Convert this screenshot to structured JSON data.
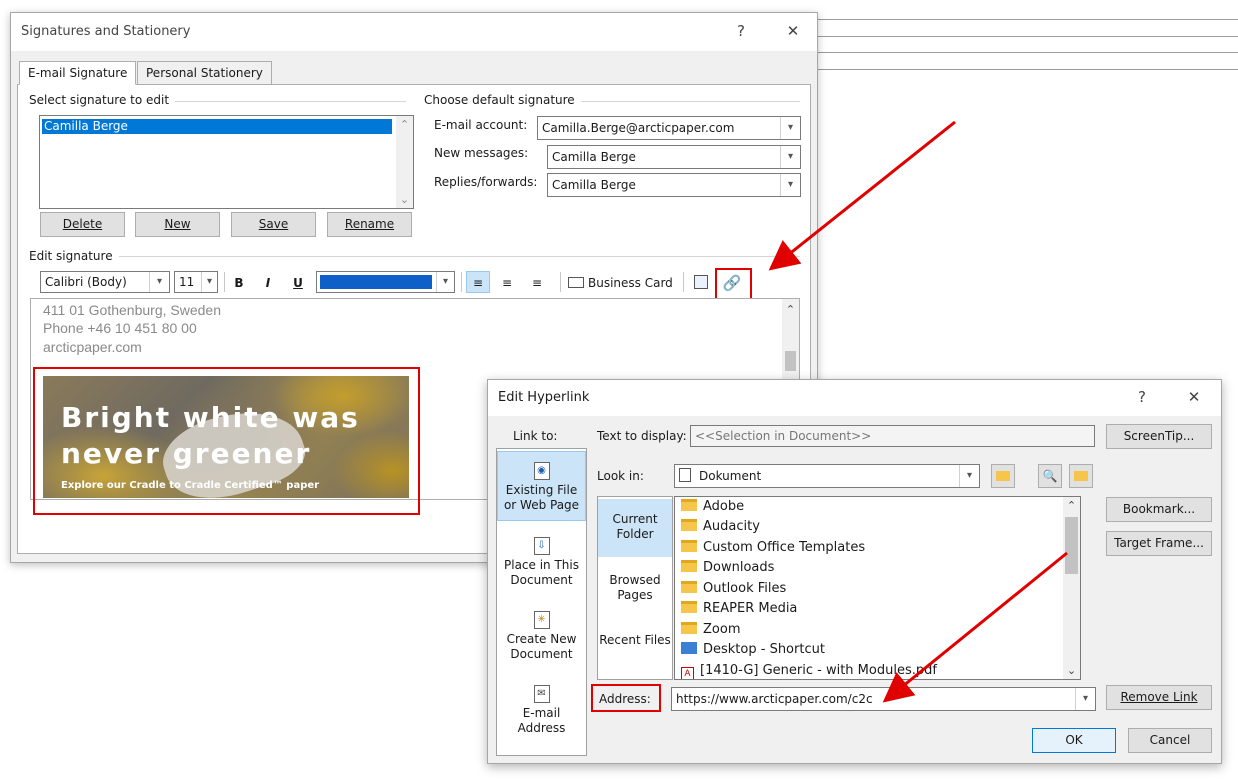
{
  "sig_dialog": {
    "title": "Signatures and Stationery",
    "help_glyph": "?",
    "close_glyph": "✕",
    "tabs": [
      {
        "label": "E-mail Signature"
      },
      {
        "label": "Personal Stationery"
      }
    ],
    "select_label": "Select signature to edit",
    "signatures": [
      "Camilla Berge"
    ],
    "buttons": {
      "delete": "Delete",
      "new": "New",
      "save": "Save",
      "rename": "Rename"
    },
    "default_label": "Choose default signature",
    "email_account_label": "E-mail account:",
    "email_account_value": "Camilla.Berge@arcticpaper.com",
    "new_messages_label": "New messages:",
    "new_messages_value": "Camilla Berge",
    "replies_label": "Replies/forwards:",
    "replies_value": "Camilla Berge",
    "edit_label": "Edit signature",
    "toolbar": {
      "font": "Calibri (Body)",
      "size": "11",
      "bold": "B",
      "italic": "I",
      "underline": "U",
      "font_color": "#0f5fc8",
      "business_card": "Business Card"
    },
    "signature_lines": [
      "411 01 Gothenburg, Sweden",
      "Phone +46 10 451 80 00",
      "arcticpaper.com"
    ],
    "banner": {
      "line1": "Bright white was",
      "line2": "never greener",
      "line3": "Explore our Cradle to Cradle Certified™ paper"
    }
  },
  "hl_dialog": {
    "title": "Edit Hyperlink",
    "help_glyph": "?",
    "close_glyph": "✕",
    "link_to_label": "Link to:",
    "link_to_items": [
      {
        "label": "Existing File or Web Page"
      },
      {
        "label": "Place in This Document"
      },
      {
        "label": "Create New Document"
      },
      {
        "label": "E-mail Address"
      }
    ],
    "text_to_display_label": "Text to display:",
    "text_to_display_value": "<<Selection in Document>>",
    "screentip": "ScreenTip...",
    "look_in_label": "Look in:",
    "look_in_value": "Dokument",
    "browse_items": [
      {
        "label": "Current Folder"
      },
      {
        "label": "Browsed Pages"
      },
      {
        "label": "Recent Files"
      }
    ],
    "files": [
      {
        "name": "Adobe",
        "type": "folder"
      },
      {
        "name": "Audacity",
        "type": "folder"
      },
      {
        "name": "Custom Office Templates",
        "type": "folder"
      },
      {
        "name": "Downloads",
        "type": "folder"
      },
      {
        "name": "Outlook Files",
        "type": "folder"
      },
      {
        "name": "REAPER Media",
        "type": "folder"
      },
      {
        "name": "Zoom",
        "type": "folder"
      },
      {
        "name": "Desktop - Shortcut",
        "type": "shortcut"
      },
      {
        "name": "[1410-G] Generic - with Modules.pdf",
        "type": "pdf"
      }
    ],
    "bookmark": "Bookmark...",
    "target_frame": "Target Frame...",
    "address_label": "Address:",
    "address_value": "https://www.arcticpaper.com/c2c",
    "remove_link": "Remove Link",
    "ok": "OK",
    "cancel": "Cancel"
  },
  "annotation_color": "#e00000"
}
